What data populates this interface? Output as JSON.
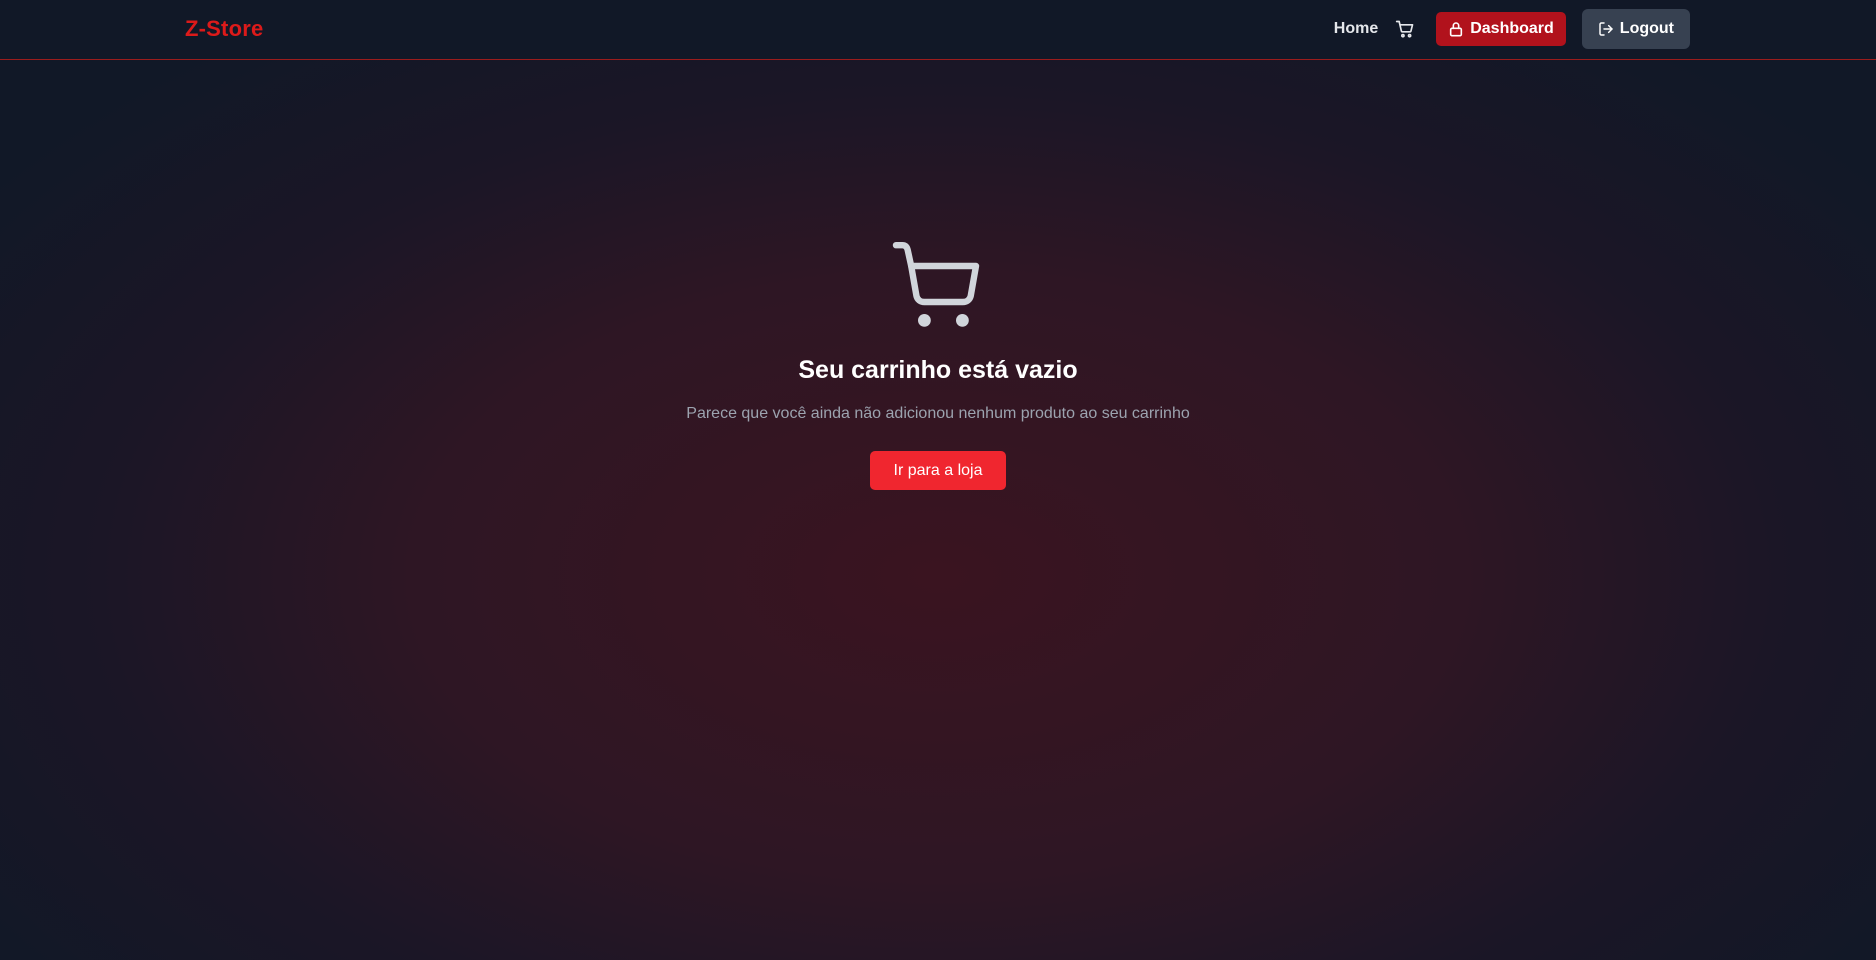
{
  "navbar": {
    "brand": "Z-Store",
    "home_label": "Home",
    "cart_icon": "cart-icon",
    "dashboard_label": "Dashboard",
    "dashboard_icon": "lock-icon",
    "logout_label": "Logout",
    "logout_icon": "logout-icon"
  },
  "empty_cart": {
    "icon": "shopping-cart-icon",
    "title": "Seu carrinho está vazio",
    "subtitle": "Parece que você ainda não adicionou nenhum produto ao seu carrinho",
    "button_label": "Ir para a loja"
  },
  "colors": {
    "brand": "#dc1a1a",
    "navbar_bg": "#111827",
    "dashboard_button": "#b1121c",
    "logout_button": "#374151",
    "primary_button": "#f0262f",
    "muted_text": "#9ca3af"
  }
}
